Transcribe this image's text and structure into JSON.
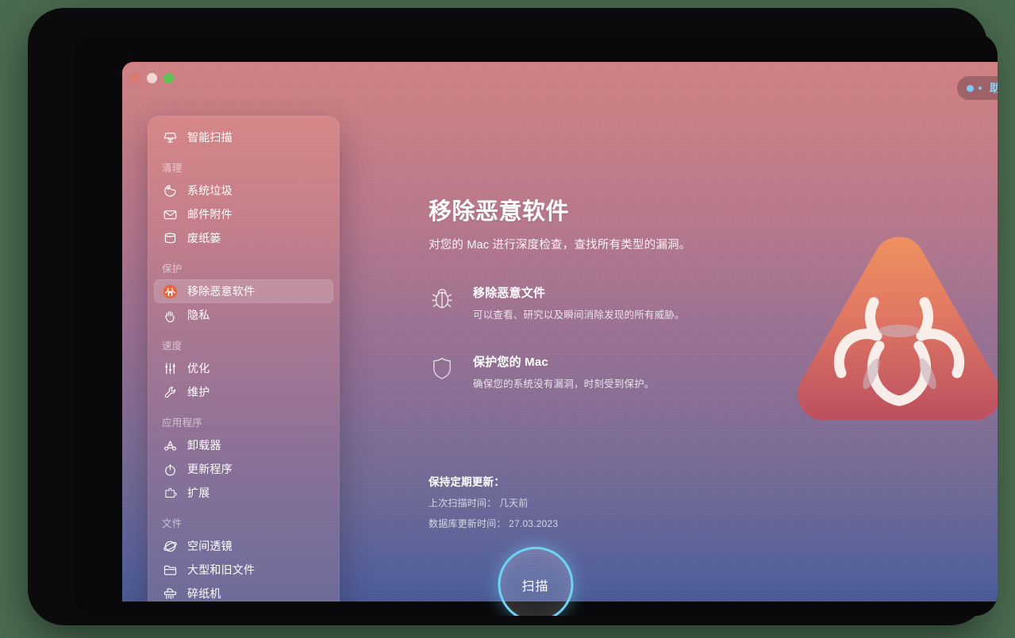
{
  "window": {
    "traffic_lights": [
      {
        "name": "close",
        "color": "#d9766f"
      },
      {
        "name": "minimize",
        "color": "#f0d6cc"
      },
      {
        "name": "maximize",
        "color": "#5fc254"
      }
    ]
  },
  "assistant": {
    "label": "助手",
    "accent": "#8ed2f6"
  },
  "sidebar": {
    "top_items": [
      {
        "icon": "smart-scan-icon",
        "label": "智能扫描"
      }
    ],
    "groups": [
      {
        "label": "清理",
        "items": [
          {
            "icon": "system-junk-icon",
            "label": "系统垃圾"
          },
          {
            "icon": "mail-attachments-icon",
            "label": "邮件附件"
          },
          {
            "icon": "trash-bin-icon",
            "label": "废纸篓"
          }
        ]
      },
      {
        "label": "保护",
        "items": [
          {
            "icon": "malware-removal-icon",
            "label": "移除恶意软件",
            "active": true
          },
          {
            "icon": "privacy-hand-icon",
            "label": "隐私"
          }
        ]
      },
      {
        "label": "速度",
        "items": [
          {
            "icon": "optimization-sliders-icon",
            "label": "优化"
          },
          {
            "icon": "maintenance-wrench-icon",
            "label": "维护"
          }
        ]
      },
      {
        "label": "应用程序",
        "items": [
          {
            "icon": "uninstaller-icon",
            "label": "卸载器"
          },
          {
            "icon": "updater-icon",
            "label": "更新程序"
          },
          {
            "icon": "extensions-icon",
            "label": "扩展"
          }
        ]
      },
      {
        "label": "文件",
        "items": [
          {
            "icon": "space-lens-icon",
            "label": "空间透镜"
          },
          {
            "icon": "large-old-files-icon",
            "label": "大型和旧文件"
          },
          {
            "icon": "shredder-icon",
            "label": "碎纸机"
          }
        ]
      }
    ]
  },
  "main": {
    "title": "移除恶意软件",
    "subtitle": "对您的 Mac 进行深度检查，查找所有类型的漏洞。",
    "features": [
      {
        "icon": "bug-icon",
        "title": "移除恶意文件",
        "desc": "可以查看、研究以及瞬间消除发现的所有威胁。"
      },
      {
        "icon": "shield-icon",
        "title": "保护您的 Mac",
        "desc": "确保您的系统没有漏洞，时刻受到保护。"
      }
    ],
    "update_block": {
      "heading": "保持定期更新：",
      "last_scan_label": "上次扫描时间：",
      "last_scan_value": "几天前",
      "db_update_label": "数据库更新时间：",
      "db_update_value": "27.03.2023"
    },
    "hero": {
      "icon": "biohazard-warning-badge",
      "gradient_from": "#e98a5e",
      "gradient_to": "#c05360"
    },
    "scan_button": {
      "label": "扫描",
      "ring_color": "#6fd3f5"
    }
  }
}
